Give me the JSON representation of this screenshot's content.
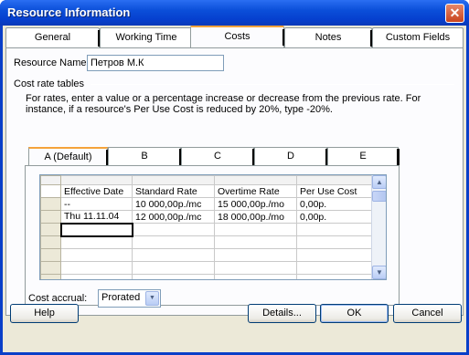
{
  "window": {
    "title": "Resource Information",
    "close_glyph": "✕"
  },
  "tabs": [
    {
      "label": "General"
    },
    {
      "label": "Working Time"
    },
    {
      "label": "Costs"
    },
    {
      "label": "Notes"
    },
    {
      "label": "Custom Fields"
    }
  ],
  "resource_name": {
    "label": "Resource Name:",
    "value": "Петров М.К"
  },
  "cost_rate_tables": {
    "label": "Cost rate tables",
    "hint_line1": "For rates, enter a value or a percentage increase or decrease from the previous rate. For",
    "hint_line2": "instance, if a resource's Per Use Cost is reduced by 20%, type -20%."
  },
  "rate_tabs": [
    {
      "label": "A (Default)"
    },
    {
      "label": "B"
    },
    {
      "label": "C"
    },
    {
      "label": "D"
    },
    {
      "label": "E"
    }
  ],
  "grid": {
    "headers": [
      "Effective Date",
      "Standard Rate",
      "Overtime Rate",
      "Per Use Cost"
    ],
    "rows": [
      [
        "--",
        "10 000,00р./mc",
        "15 000,00р./mo",
        "0,00р."
      ],
      [
        "Thu 11.11.04",
        "12 000,00р./mc",
        "18 000,00р./mo",
        "0,00р."
      ]
    ]
  },
  "cost_accrual": {
    "label": "Cost accrual:",
    "value": "Prorated"
  },
  "buttons": {
    "help": "Help",
    "details": "Details...",
    "ok": "OK",
    "cancel": "Cancel"
  },
  "scroll": {
    "up": "▲",
    "down": "▼"
  },
  "dropdown_glyph": "▼"
}
